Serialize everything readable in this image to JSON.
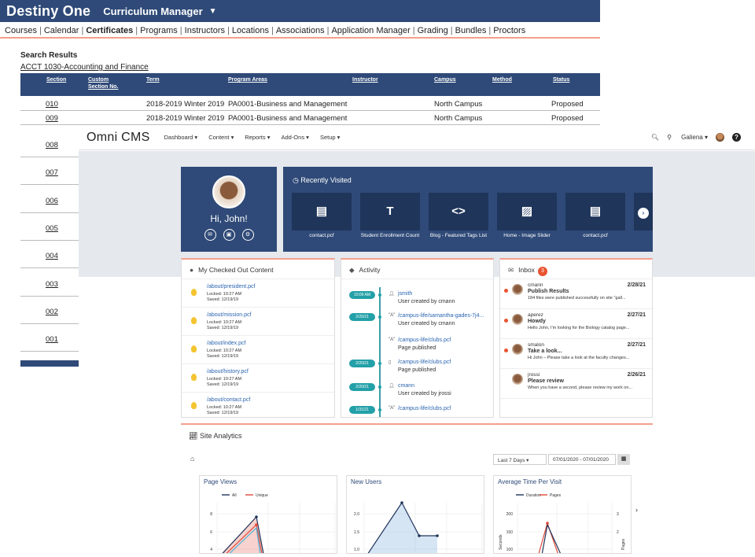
{
  "destiny": {
    "logo": "Destiny One",
    "module": "Curriculum Manager",
    "nav": [
      "Courses",
      "Calendar",
      "Certificates",
      "Programs",
      "Instructors",
      "Locations",
      "Associations",
      "Application Manager",
      "Grading",
      "Bundles",
      "Proctors"
    ],
    "active_nav": "Certificates",
    "search_title": "Search Results",
    "course": "ACCT 1030-Accounting and Finance",
    "columns": [
      "Section",
      "Custom Section No.",
      "Term",
      "Program Areas",
      "Instructor",
      "Campus",
      "Method",
      "Status"
    ],
    "rows": [
      {
        "section": "010",
        "term": "2018-2019 Winter 2019",
        "program": "PA0001-Business and Management",
        "campus": "North Campus",
        "status": "Proposed"
      },
      {
        "section": "009",
        "term": "2018-2019 Winter 2019",
        "program": "PA0001-Business and Management",
        "campus": "North Campus",
        "status": "Proposed"
      }
    ],
    "hidden_sections": [
      "008",
      "007",
      "006",
      "005",
      "004",
      "003",
      "002",
      "001"
    ]
  },
  "omni": {
    "logo": "Omni CMS",
    "menu": [
      "Dashboard",
      "Content",
      "Reports",
      "Add-Ons",
      "Setup"
    ],
    "site": "Galiena",
    "help": "?",
    "greeting": "Hi, John!",
    "recent_title": "Recently Visited",
    "recent": [
      {
        "icon": "PDF",
        "label": "contact.pcf"
      },
      {
        "icon": "T",
        "label": "Student Enrollment Count"
      },
      {
        "icon": "<>",
        "label": "Blog - Featured Tags List"
      },
      {
        "icon": "IMG",
        "label": "Home - Image Slider"
      },
      {
        "icon": "PDF",
        "label": "contact.pcf"
      }
    ],
    "checked_title": "My Checked Out Content",
    "checked": [
      {
        "path": "/about/president.pcf",
        "locked": "Locked: 10:27 AM",
        "saved": "Saved: 12/19/19"
      },
      {
        "path": "/about/mission.pcf",
        "locked": "Locked: 10:27 AM",
        "saved": "Saved: 12/19/19"
      },
      {
        "path": "/about/index.pcf",
        "locked": "Locked: 10:27 AM",
        "saved": "Saved: 12/19/19"
      },
      {
        "path": "/about/history.pcf",
        "locked": "Locked: 10:27 AM",
        "saved": "Saved: 12/19/19"
      },
      {
        "path": "/about/contact.pcf",
        "locked": "Locked: 10:27 AM",
        "saved": "Saved: 12/19/19"
      }
    ],
    "activity_title": "Activity",
    "activity": [
      {
        "date": "10:09 AM",
        "icon": "user",
        "l1": "jsmith",
        "l2": "User created by cmann"
      },
      {
        "date": "2/25/21",
        "icon": "A",
        "l1": "/campus-life/samantha-gades-7j4...",
        "l2": ""
      },
      {
        "date": "",
        "icon": "A",
        "l1": "/campus-life/clubs.pcf",
        "l2": "Page published"
      },
      {
        "date": "2/20/21",
        "icon": "file",
        "l1": "/campus-life/clubs.pcf",
        "l2": "Page published"
      },
      {
        "date": "2/20/21",
        "icon": "user",
        "l1": "cmann",
        "l2": "User created by jrossi"
      },
      {
        "date": "1/31/21",
        "icon": "A",
        "l1": "/campus-life/clubs.pcf",
        "l2": ""
      }
    ],
    "activity_extra": "User created by cmann",
    "inbox_title": "Inbox",
    "inbox_count": "3",
    "inbox": [
      {
        "from": "cmann",
        "subject": "Publish Results",
        "body": "184 files were published successfully on site \"gall...",
        "date": "2/28/21",
        "unread": true
      },
      {
        "from": "aperez",
        "subject": "Howdy",
        "body": "Hello John, I'm looking for the Biology catalog page...",
        "date": "2/27/21",
        "unread": true
      },
      {
        "from": "smalon",
        "subject": "Take a look...",
        "body": "Hi John – Please take a look at the faculty changes...",
        "date": "2/27/21",
        "unread": true
      },
      {
        "from": "jrossi",
        "subject": "Please review",
        "body": "When you have a second, please review my work on...",
        "date": "2/26/21",
        "unread": false
      }
    ],
    "analytics_title": "Site Analytics",
    "range": "Last 7 Days",
    "date_range": "07/01/2020 - 07/01/2020"
  },
  "chart_data": [
    {
      "type": "line",
      "title": "Page Views",
      "series": [
        {
          "name": "All",
          "color": "#1f355a"
        },
        {
          "name": "Unique",
          "color": "#e04a3a"
        }
      ],
      "y_ticks": [
        "8",
        "6",
        "4"
      ]
    },
    {
      "type": "area",
      "title": "New Users",
      "y_ticks": [
        "2.0",
        "1.5",
        "1.0"
      ]
    },
    {
      "type": "line",
      "title": "Average Time Per Visit",
      "series": [
        {
          "name": "Duration",
          "color": "#1f355a"
        },
        {
          "name": "Pages",
          "color": "#e04a3a"
        }
      ],
      "y_ticks": [
        "200",
        "150",
        "100"
      ],
      "y_right_ticks": [
        "3",
        "2"
      ],
      "ylabel": "Seconds",
      "ylabel_right": "Pages"
    }
  ]
}
